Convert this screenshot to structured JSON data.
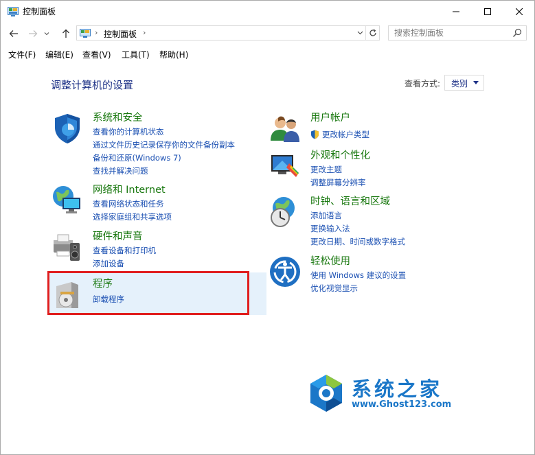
{
  "window": {
    "title": "控制面板"
  },
  "address": {
    "crumb": "控制面板",
    "sep": "›"
  },
  "search": {
    "placeholder": "搜索控制面板"
  },
  "menu": [
    "文件(F)",
    "编辑(E)",
    "查看(V)",
    "工具(T)",
    "帮助(H)"
  ],
  "content": {
    "title": "调整计算机的设置",
    "view_by_label": "查看方式:",
    "view_by_value": "类别"
  },
  "categories": {
    "system": {
      "title": "系统和安全",
      "links": [
        "查看你的计算机状态",
        "通过文件历史记录保存你的文件备份副本",
        "备份和还原(Windows 7)",
        "查找并解决问题"
      ]
    },
    "network": {
      "title": "网络和 Internet",
      "links": [
        "查看网络状态和任务",
        "选择家庭组和共享选项"
      ]
    },
    "hardware": {
      "title": "硬件和声音",
      "links": [
        "查看设备和打印机",
        "添加设备"
      ]
    },
    "programs": {
      "title": "程序",
      "links": [
        "卸载程序"
      ]
    },
    "users": {
      "title": "用户帐户",
      "links": [
        "更改帐户类型"
      ]
    },
    "appearance": {
      "title": "外观和个性化",
      "links": [
        "更改主题",
        "调整屏幕分辨率"
      ]
    },
    "clock": {
      "title": "时钟、语言和区域",
      "links": [
        "添加语言",
        "更换输入法",
        "更改日期、时间或数字格式"
      ]
    },
    "ease": {
      "title": "轻松使用",
      "links": [
        "使用 Windows 建议的设置",
        "优化视觉显示"
      ]
    }
  },
  "watermark": {
    "name": "系统之家",
    "url": "www.Ghost123.com"
  },
  "colors": {
    "category_title": "#19780f",
    "link": "#1a4fb2",
    "page_title": "#1e3287",
    "highlight": "#e5f1fb",
    "annotation_box": "#e01e1e"
  }
}
